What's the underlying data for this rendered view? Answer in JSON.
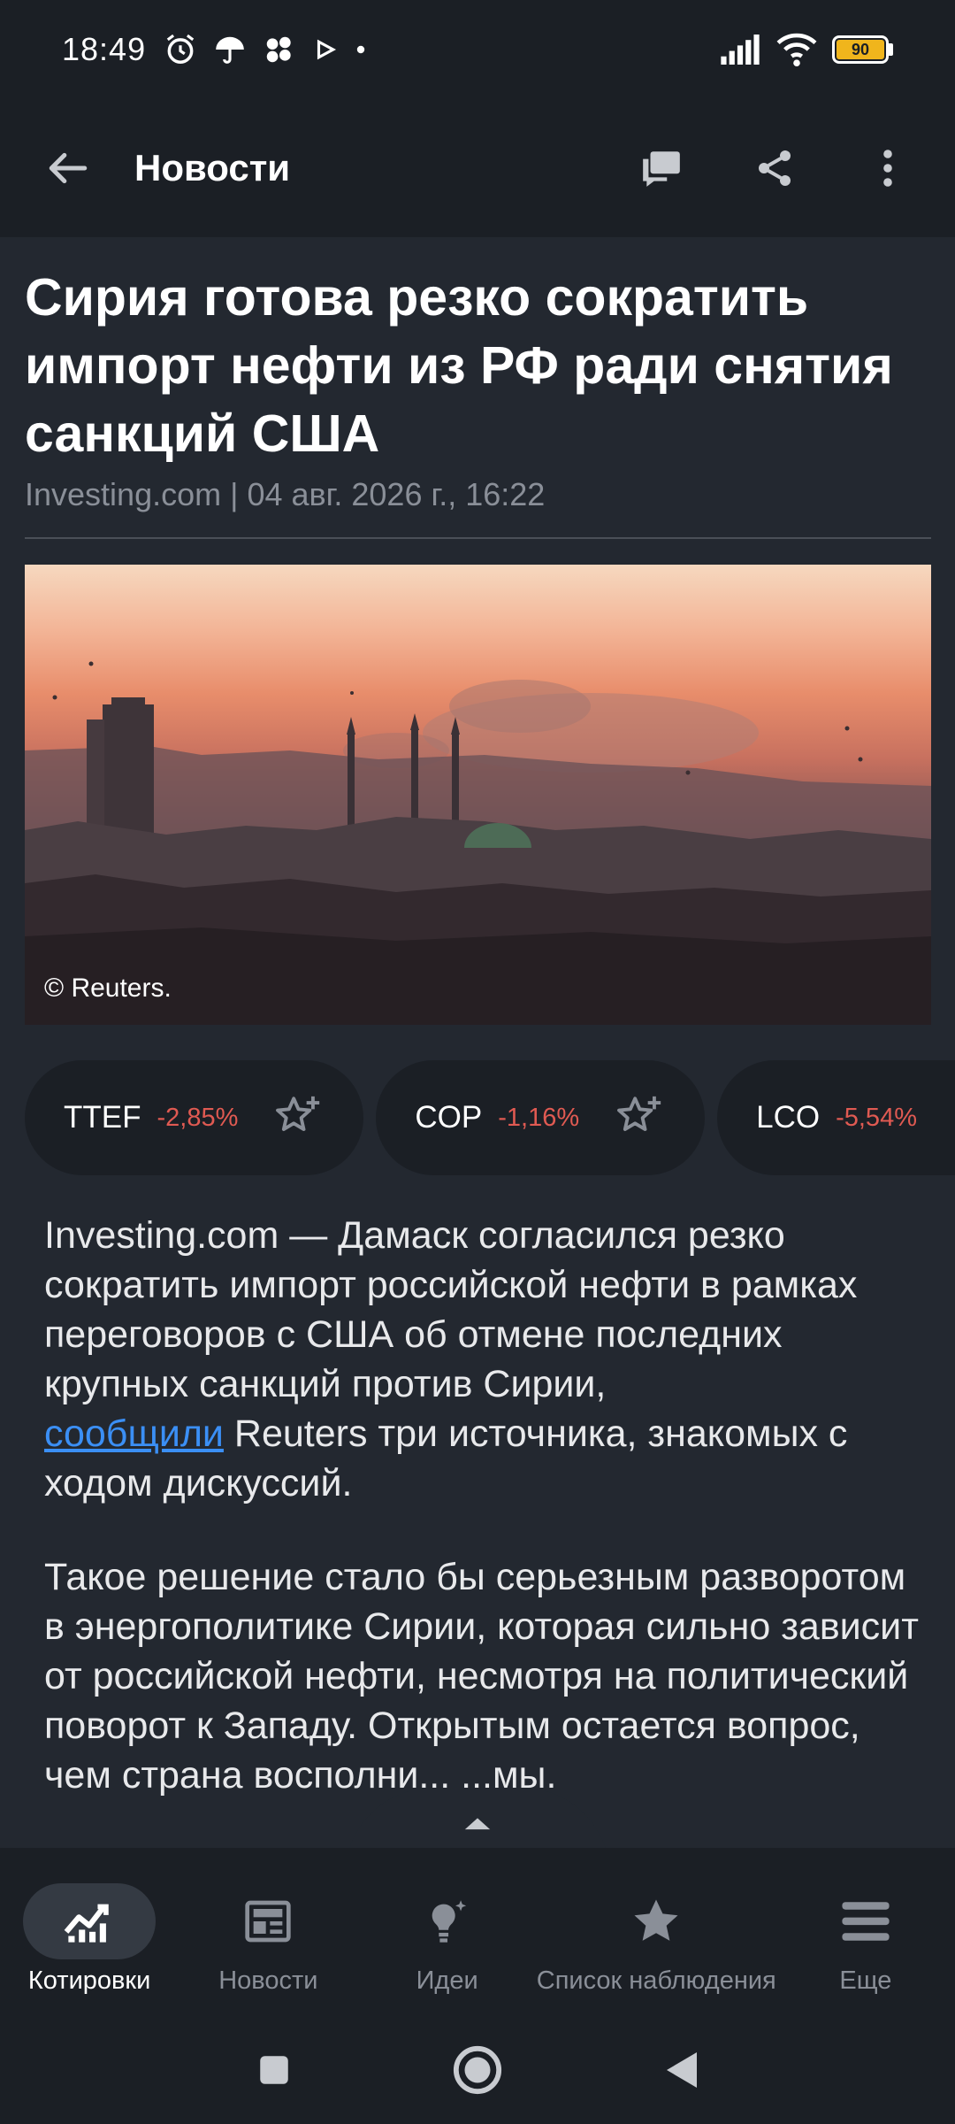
{
  "status_bar": {
    "time": "18:49",
    "battery_level": "90",
    "icons_left": [
      "alarm-icon",
      "umbrella-icon",
      "app-icon",
      "play-icon",
      "dot-icon"
    ],
    "icons_right": [
      "signal-icon",
      "wifi-icon",
      "battery-icon"
    ]
  },
  "app_bar": {
    "title": "Новости",
    "actions": [
      "comments-icon",
      "share-icon",
      "more-icon"
    ]
  },
  "article": {
    "headline": "Сирия готова резко сократить импорт нефти из РФ ради снятия санкций США",
    "meta": "Investing.com | 04 авг. 2026 г., 16:22",
    "image_caption": "© Reuters.",
    "tickers": [
      {
        "symbol": "TTEF",
        "change": "-2,85%"
      },
      {
        "symbol": "COP",
        "change": "-1,16%"
      },
      {
        "symbol": "LCO",
        "change": "-5,54%"
      }
    ],
    "p1_before_link": "Investing.com — Дамаск согласился резко сократить импорт российской нефти в рамках переговоров с США об отмене последних крупных санкций против Сирии,",
    "p1_link": "сообщили",
    "p1_after_link": " Reuters три источника, знакомых с ходом дискуссий.",
    "p2": "Такое решение стало бы серьезным разворотом в энергополитике Сирии, которая сильно зависит от российской нефти, несмотря на политический поворот к Западу. Открытым остается вопрос, чем страна восполни... ...мы."
  },
  "bottom_nav": [
    {
      "label": "Котировки",
      "icon": "chart-icon",
      "active": true
    },
    {
      "label": "Новости",
      "icon": "newspaper-icon",
      "active": false
    },
    {
      "label": "Идеи",
      "icon": "lightbulb-icon",
      "active": false
    },
    {
      "label": "Список наблюдения",
      "icon": "star-icon",
      "active": false
    },
    {
      "label": "Еще",
      "icon": "menu-icon",
      "active": false
    }
  ],
  "colors": {
    "background": "#232830",
    "bar": "#1b1f25",
    "negative": "#e05a52",
    "link": "#3b8ff5",
    "battery": "#f0b51c"
  }
}
